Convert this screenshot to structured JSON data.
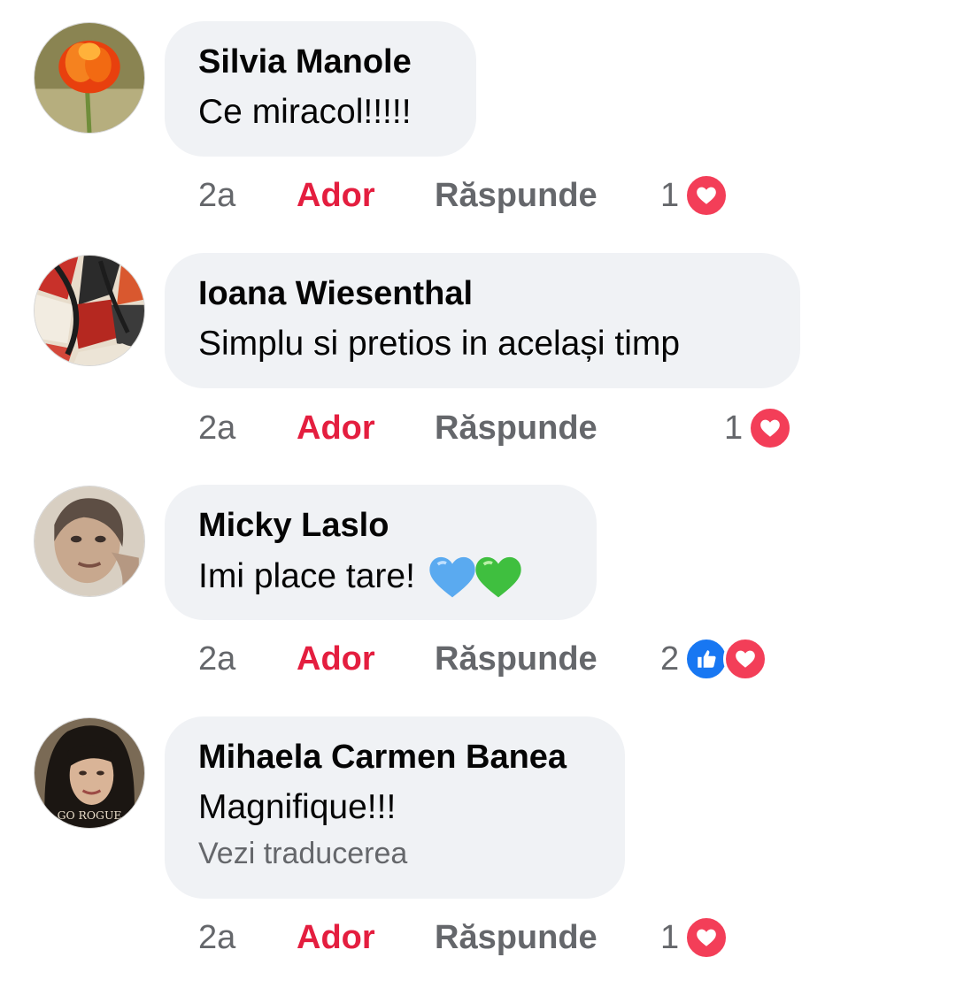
{
  "comments": [
    {
      "author": "Silvia Manole",
      "text": "Ce miracol!!!!!",
      "time": "2a",
      "love_label": "Ador",
      "reply_label": "Răspunde",
      "reaction_count": "1",
      "reactions": [
        "heart-icon"
      ]
    },
    {
      "author": "Ioana Wiesenthal",
      "text": "Simplu si pretios in același timp",
      "time": "2a",
      "love_label": "Ador",
      "reply_label": "Răspunde",
      "reaction_count": "1",
      "reactions": [
        "heart-icon"
      ]
    },
    {
      "author": "Micky Laslo",
      "text": "Imi place tare!",
      "emojis": [
        "blue-heart-emoji",
        "green-heart-emoji"
      ],
      "time": "2a",
      "love_label": "Ador",
      "reply_label": "Răspunde",
      "reaction_count": "2",
      "reactions": [
        "like-icon",
        "heart-icon"
      ]
    },
    {
      "author": "Mihaela Carmen Banea",
      "text": "Magnifique!!!",
      "translate_label": "Vezi traducerea",
      "time": "2a",
      "love_label": "Ador",
      "reply_label": "Răspunde",
      "reaction_count": "1",
      "reactions": [
        "heart-icon"
      ]
    }
  ],
  "avatar_texts": {
    "mihaela_watermark": "GO ROGUE"
  },
  "colors": {
    "bubble": "#f0f2f5",
    "love_label": "#e41e3f",
    "meta_text": "#65676b",
    "heart_reaction": "#f33e58",
    "like_reaction": "#1877f2"
  }
}
